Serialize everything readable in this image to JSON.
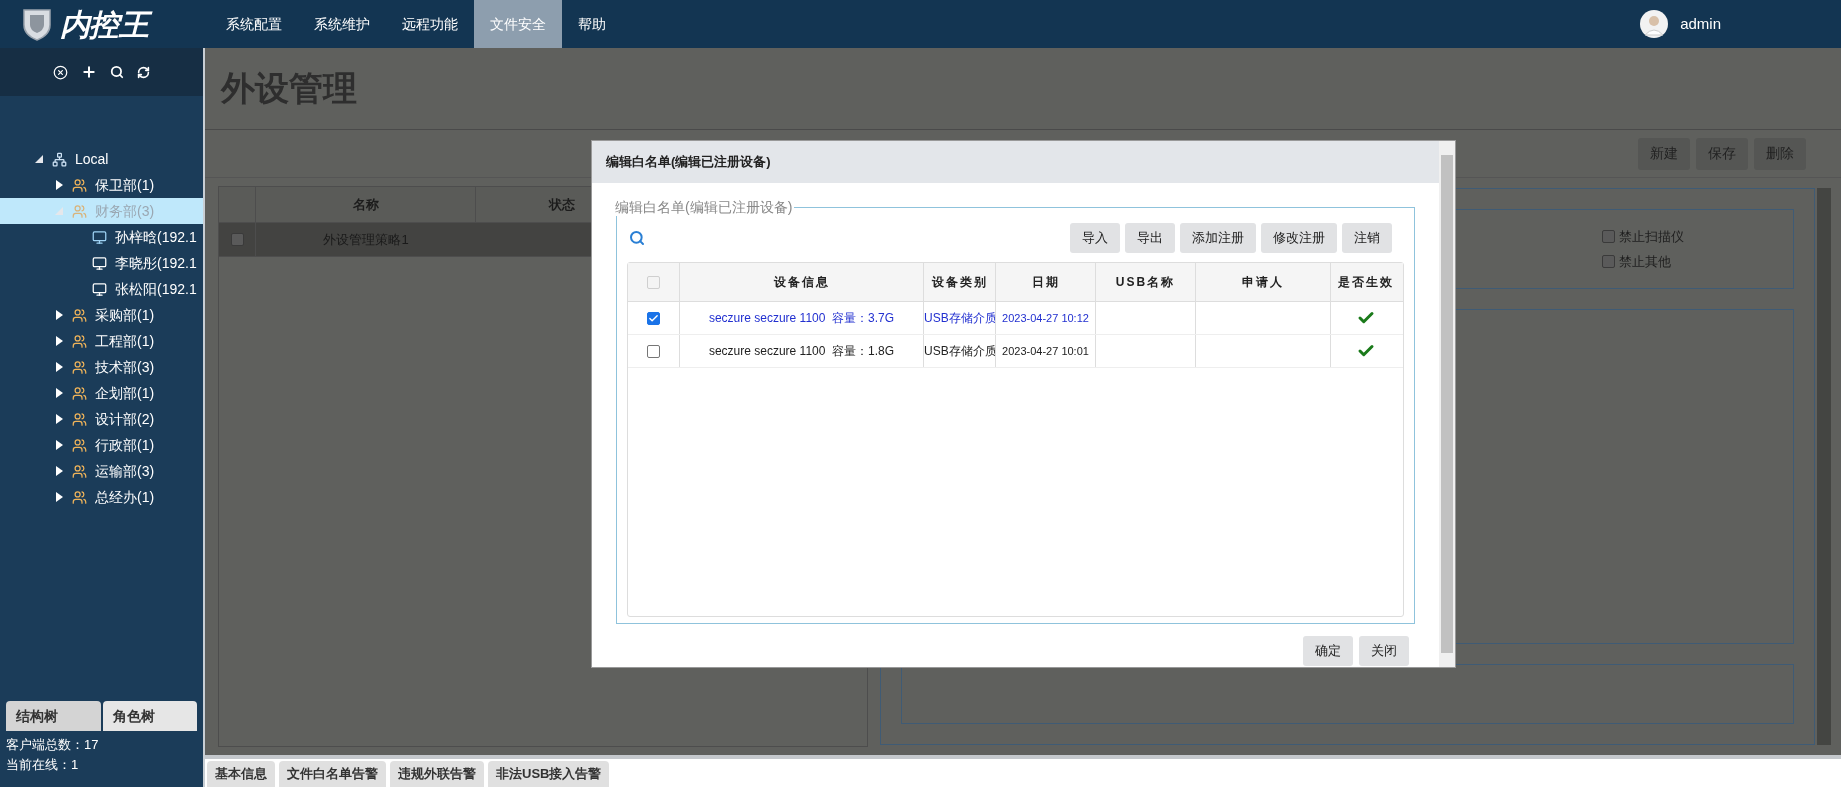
{
  "header": {
    "logo": "内控王",
    "nav": [
      {
        "label": "系统配置",
        "selected": false
      },
      {
        "label": "系统维护",
        "selected": false
      },
      {
        "label": "远程功能",
        "selected": false
      },
      {
        "label": "文件安全",
        "selected": true
      },
      {
        "label": "帮助",
        "selected": false
      }
    ],
    "user": "admin"
  },
  "sidebar": {
    "tree": [
      {
        "label": "Local",
        "kind": "root",
        "expanded": true,
        "selected": false,
        "children": [
          {
            "label": "保卫部(1)",
            "kind": "group",
            "expanded": false,
            "selected": false
          },
          {
            "label": "财务部(3)",
            "kind": "group",
            "expanded": true,
            "selected": true,
            "children": [
              {
                "label": "孙梓晗(192.1",
                "kind": "computer",
                "online": true,
                "selected": false
              },
              {
                "label": "李晓彤(192.1",
                "kind": "computer",
                "online": false,
                "selected": false
              },
              {
                "label": "张松阳(192.1",
                "kind": "computer",
                "online": false,
                "selected": false
              }
            ]
          },
          {
            "label": "采购部(1)",
            "kind": "group",
            "expanded": false,
            "selected": false
          },
          {
            "label": "工程部(1)",
            "kind": "group",
            "expanded": false,
            "selected": false
          },
          {
            "label": "技术部(3)",
            "kind": "group",
            "expanded": false,
            "selected": false
          },
          {
            "label": "企划部(1)",
            "kind": "group",
            "expanded": false,
            "selected": false
          },
          {
            "label": "设计部(2)",
            "kind": "group",
            "expanded": false,
            "selected": false
          },
          {
            "label": "行政部(1)",
            "kind": "group",
            "expanded": false,
            "selected": false
          },
          {
            "label": "运输部(3)",
            "kind": "group",
            "expanded": false,
            "selected": false
          },
          {
            "label": "总经办(1)",
            "kind": "group",
            "expanded": false,
            "selected": false
          }
        ]
      }
    ],
    "tabs": [
      {
        "label": "结构树",
        "selected": true
      },
      {
        "label": "角色树",
        "selected": false
      }
    ],
    "stats": [
      "客户端总数：17",
      "当前在线：1"
    ]
  },
  "page": {
    "title": "外设管理",
    "buttons": [
      "新建",
      "保存",
      "删除"
    ],
    "policy_table": {
      "columns": [
        "名称",
        "状态"
      ],
      "rows": [
        {
          "name": "外设管理策略1",
          "checked": false
        }
      ]
    },
    "options": [
      {
        "label": "禁止扫描仪",
        "checked": false
      },
      {
        "label": "禁止其他",
        "checked": false
      }
    ]
  },
  "dialog": {
    "title": "编辑白名单(编辑已注册设备)",
    "legend": "编辑白名单(编辑已注册设备)",
    "toolbar": [
      "导入",
      "导出",
      "添加注册",
      "修改注册",
      "注销"
    ],
    "columns": [
      "设备信息",
      "设备类别",
      "日期",
      "USB名称",
      "申请人",
      "是否生效"
    ],
    "select_all": {
      "checked": false
    },
    "rows": [
      {
        "device_info": "seczure seczure 1100  容量：3.7G",
        "device_type": "USB存储介质",
        "date": "2023-04-27 10:12",
        "checked": true,
        "effective": true
      },
      {
        "device_info": "seczure seczure 1100  容量：1.8G",
        "device_type": "USB存储介质",
        "date": "2023-04-27 10:01",
        "checked": false,
        "effective": true
      }
    ],
    "buttons": [
      "确定",
      "关闭"
    ]
  },
  "bottom_tabs": [
    "基本信息",
    "文件白名单告警",
    "违规外联告警",
    "非法USB接入告警"
  ]
}
